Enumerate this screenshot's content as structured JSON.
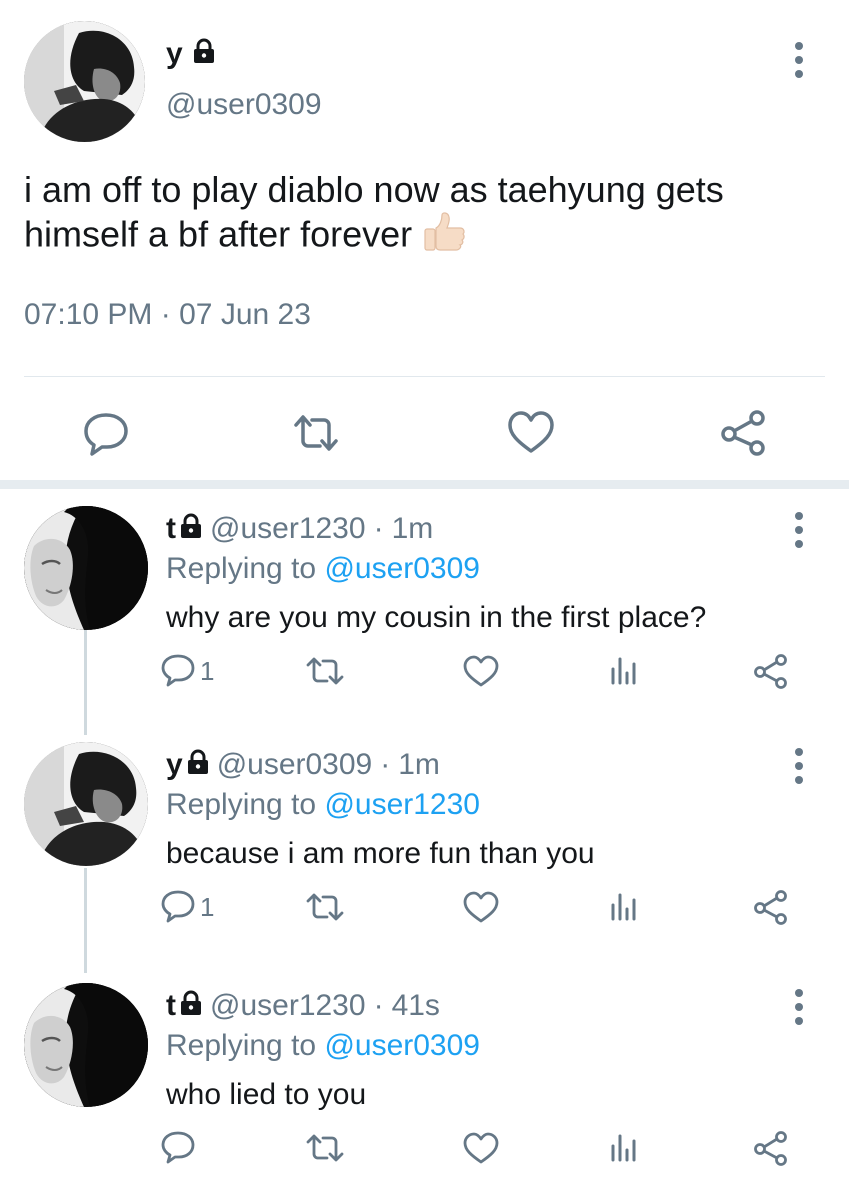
{
  "main_tweet": {
    "name": "y",
    "handle": "@user0309",
    "text": "i am off to play diablo now as taehyung gets himself a bf after forever",
    "emoji": "thumbs-up",
    "time": "07:10 PM",
    "dot": "·",
    "date": "07 Jun 23"
  },
  "replies": [
    {
      "name": "t",
      "handle": "@user1230",
      "dot": "·",
      "age": "1m",
      "replying_prefix": "Replying to",
      "replying_to": "@user0309",
      "text": "why are you my cousin in the first place?",
      "reply_count": "1",
      "avatar": "avatar-t"
    },
    {
      "name": "y",
      "handle": "@user0309",
      "dot": "·",
      "age": "1m",
      "replying_prefix": "Replying to",
      "replying_to": "@user1230",
      "text": "because i am more fun than you",
      "reply_count": "1",
      "avatar": "avatar-y"
    },
    {
      "name": "t",
      "handle": "@user1230",
      "dot": "·",
      "age": "41s",
      "replying_prefix": "Replying to",
      "replying_to": "@user0309",
      "text": "who lied to you",
      "reply_count": "",
      "avatar": "avatar-t"
    }
  ],
  "icons": {
    "reply": "reply-icon",
    "retweet": "retweet-icon",
    "like": "heart-icon",
    "stats": "stats-icon",
    "share": "share-icon",
    "more": "more-vertical-icon",
    "lock": "lock-icon"
  },
  "colors": {
    "text": "#14171a",
    "muted": "#657786",
    "link": "#1da1f2",
    "icon": "#657786"
  }
}
